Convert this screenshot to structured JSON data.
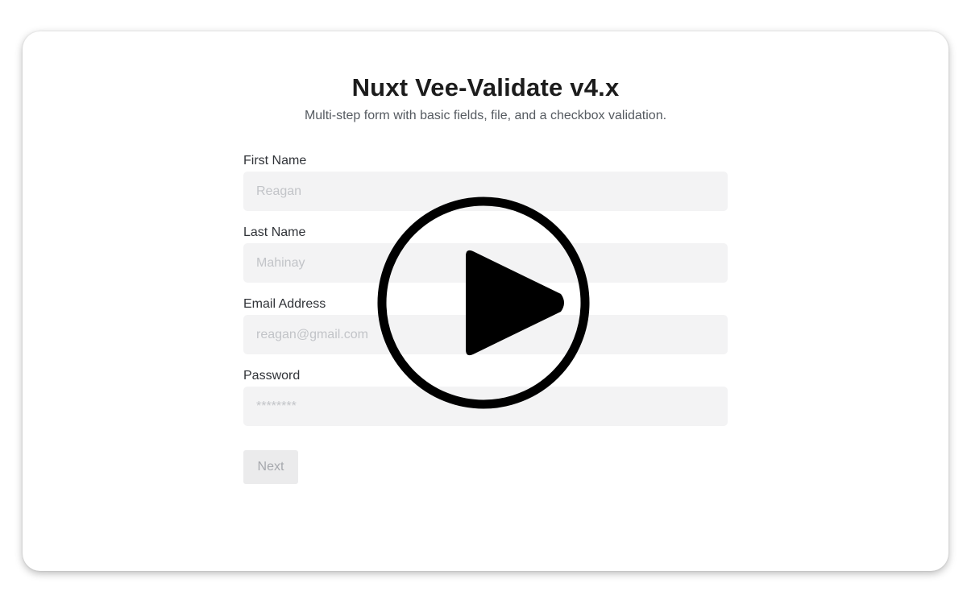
{
  "header": {
    "title": "Nuxt Vee-Validate v4.x",
    "subtitle": "Multi-step form with basic fields, file, and a checkbox validation."
  },
  "form": {
    "fields": [
      {
        "label": "First Name",
        "placeholder": "Reagan",
        "value": ""
      },
      {
        "label": "Last Name",
        "placeholder": "Mahinay",
        "value": ""
      },
      {
        "label": "Email Address",
        "placeholder": "reagan@gmail.com",
        "value": ""
      },
      {
        "label": "Password",
        "placeholder": "********",
        "value": ""
      }
    ],
    "next_label": "Next"
  },
  "overlay": {
    "icon": "play-icon",
    "color": "#000000"
  },
  "colors": {
    "input_bg": "#f3f3f4",
    "button_bg": "#ebebec",
    "title": "#1c1c1c"
  }
}
